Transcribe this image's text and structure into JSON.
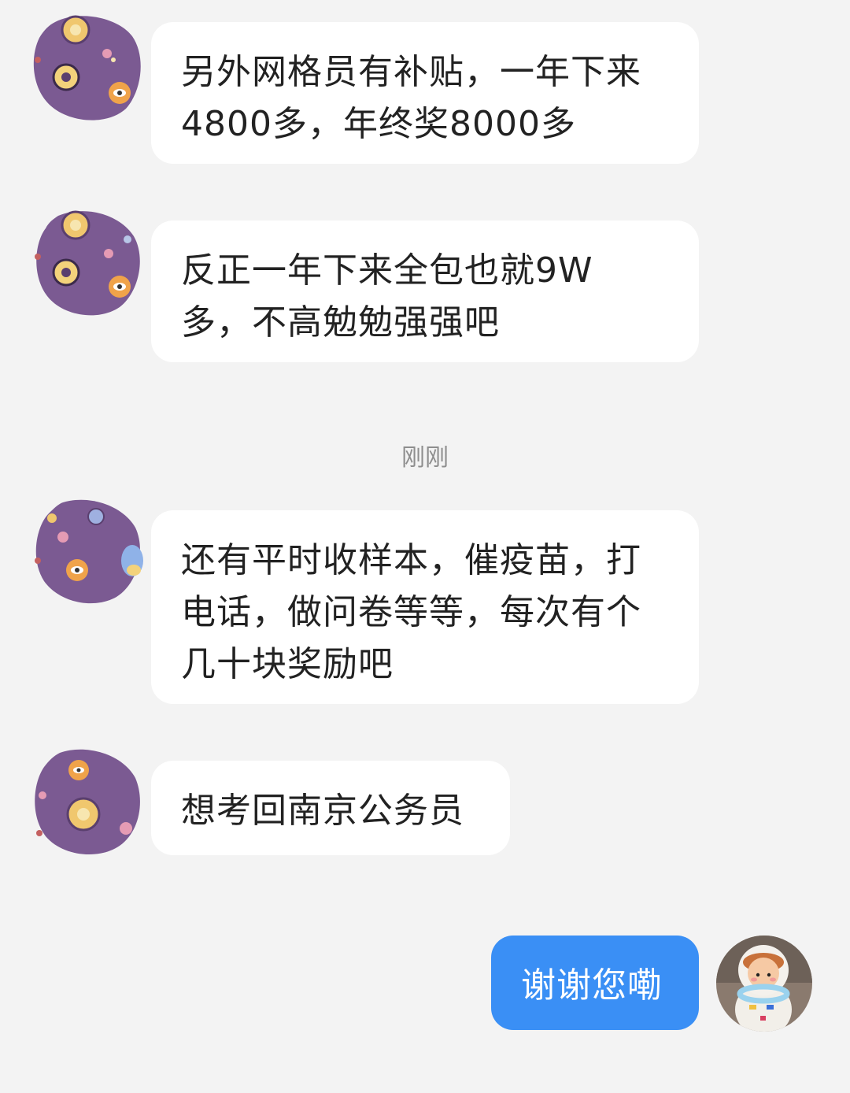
{
  "messages": [
    {
      "sender": "other",
      "text": "另外网格员有补贴，一年下来\n4800多，年终奖8000多"
    },
    {
      "sender": "other",
      "text": "反正一年下来全包也就9W\n多，不高勉勉强强吧"
    },
    {
      "sender": "other",
      "text": "还有平时收样本，催疫苗，打\n电话，做问卷等等，每次有个\n几十块奖励吧"
    },
    {
      "sender": "other",
      "text": "想考回南京公务员"
    },
    {
      "sender": "self",
      "text": "谢谢您嘞"
    }
  ],
  "timestamp": "刚刚",
  "colors": {
    "background": "#f3f3f3",
    "incoming_bubble": "#ffffff",
    "outgoing_bubble": "#3a8ff5",
    "avatar_purple": "#7b5a92"
  },
  "icons": {
    "other_avatar": "purple-pattern-avatar-icon",
    "self_avatar": "astronaut-figure-avatar-icon"
  }
}
